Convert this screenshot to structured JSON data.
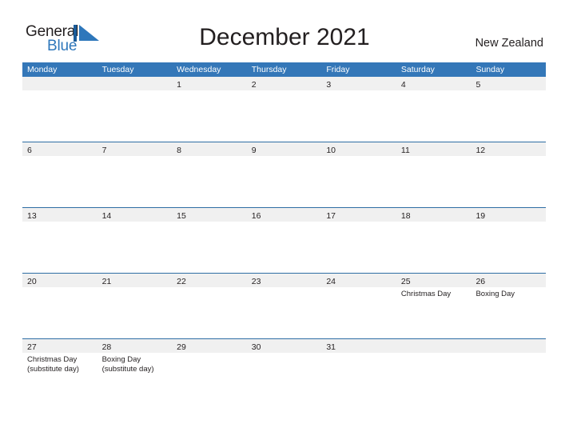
{
  "brand": {
    "word_general": "General",
    "word_blue": "Blue",
    "mark": "triangle-flag-logo",
    "color_blue": "#2e77bb",
    "color_dark": "#231f20"
  },
  "header": {
    "title": "December 2021",
    "country": "New Zealand"
  },
  "theme": {
    "header_band": "#3477b8",
    "row_line": "#2e6da4",
    "day_band": "#f0f0f0",
    "text": "#231f20"
  },
  "weekdays": [
    "Monday",
    "Tuesday",
    "Wednesday",
    "Thursday",
    "Friday",
    "Saturday",
    "Sunday"
  ],
  "weeks": [
    {
      "days": [
        {
          "num": "",
          "events": []
        },
        {
          "num": "",
          "events": []
        },
        {
          "num": "1",
          "events": []
        },
        {
          "num": "2",
          "events": []
        },
        {
          "num": "3",
          "events": []
        },
        {
          "num": "4",
          "events": []
        },
        {
          "num": "5",
          "events": []
        }
      ]
    },
    {
      "days": [
        {
          "num": "6",
          "events": []
        },
        {
          "num": "7",
          "events": []
        },
        {
          "num": "8",
          "events": []
        },
        {
          "num": "9",
          "events": []
        },
        {
          "num": "10",
          "events": []
        },
        {
          "num": "11",
          "events": []
        },
        {
          "num": "12",
          "events": []
        }
      ]
    },
    {
      "days": [
        {
          "num": "13",
          "events": []
        },
        {
          "num": "14",
          "events": []
        },
        {
          "num": "15",
          "events": []
        },
        {
          "num": "16",
          "events": []
        },
        {
          "num": "17",
          "events": []
        },
        {
          "num": "18",
          "events": []
        },
        {
          "num": "19",
          "events": []
        }
      ]
    },
    {
      "days": [
        {
          "num": "20",
          "events": []
        },
        {
          "num": "21",
          "events": []
        },
        {
          "num": "22",
          "events": []
        },
        {
          "num": "23",
          "events": []
        },
        {
          "num": "24",
          "events": []
        },
        {
          "num": "25",
          "events": [
            "Christmas Day"
          ]
        },
        {
          "num": "26",
          "events": [
            "Boxing Day"
          ]
        }
      ]
    },
    {
      "days": [
        {
          "num": "27",
          "events": [
            "Christmas Day\n(substitute day)"
          ]
        },
        {
          "num": "28",
          "events": [
            "Boxing Day\n(substitute day)"
          ]
        },
        {
          "num": "29",
          "events": []
        },
        {
          "num": "30",
          "events": []
        },
        {
          "num": "31",
          "events": []
        },
        {
          "num": "",
          "events": []
        },
        {
          "num": "",
          "events": []
        }
      ]
    }
  ]
}
